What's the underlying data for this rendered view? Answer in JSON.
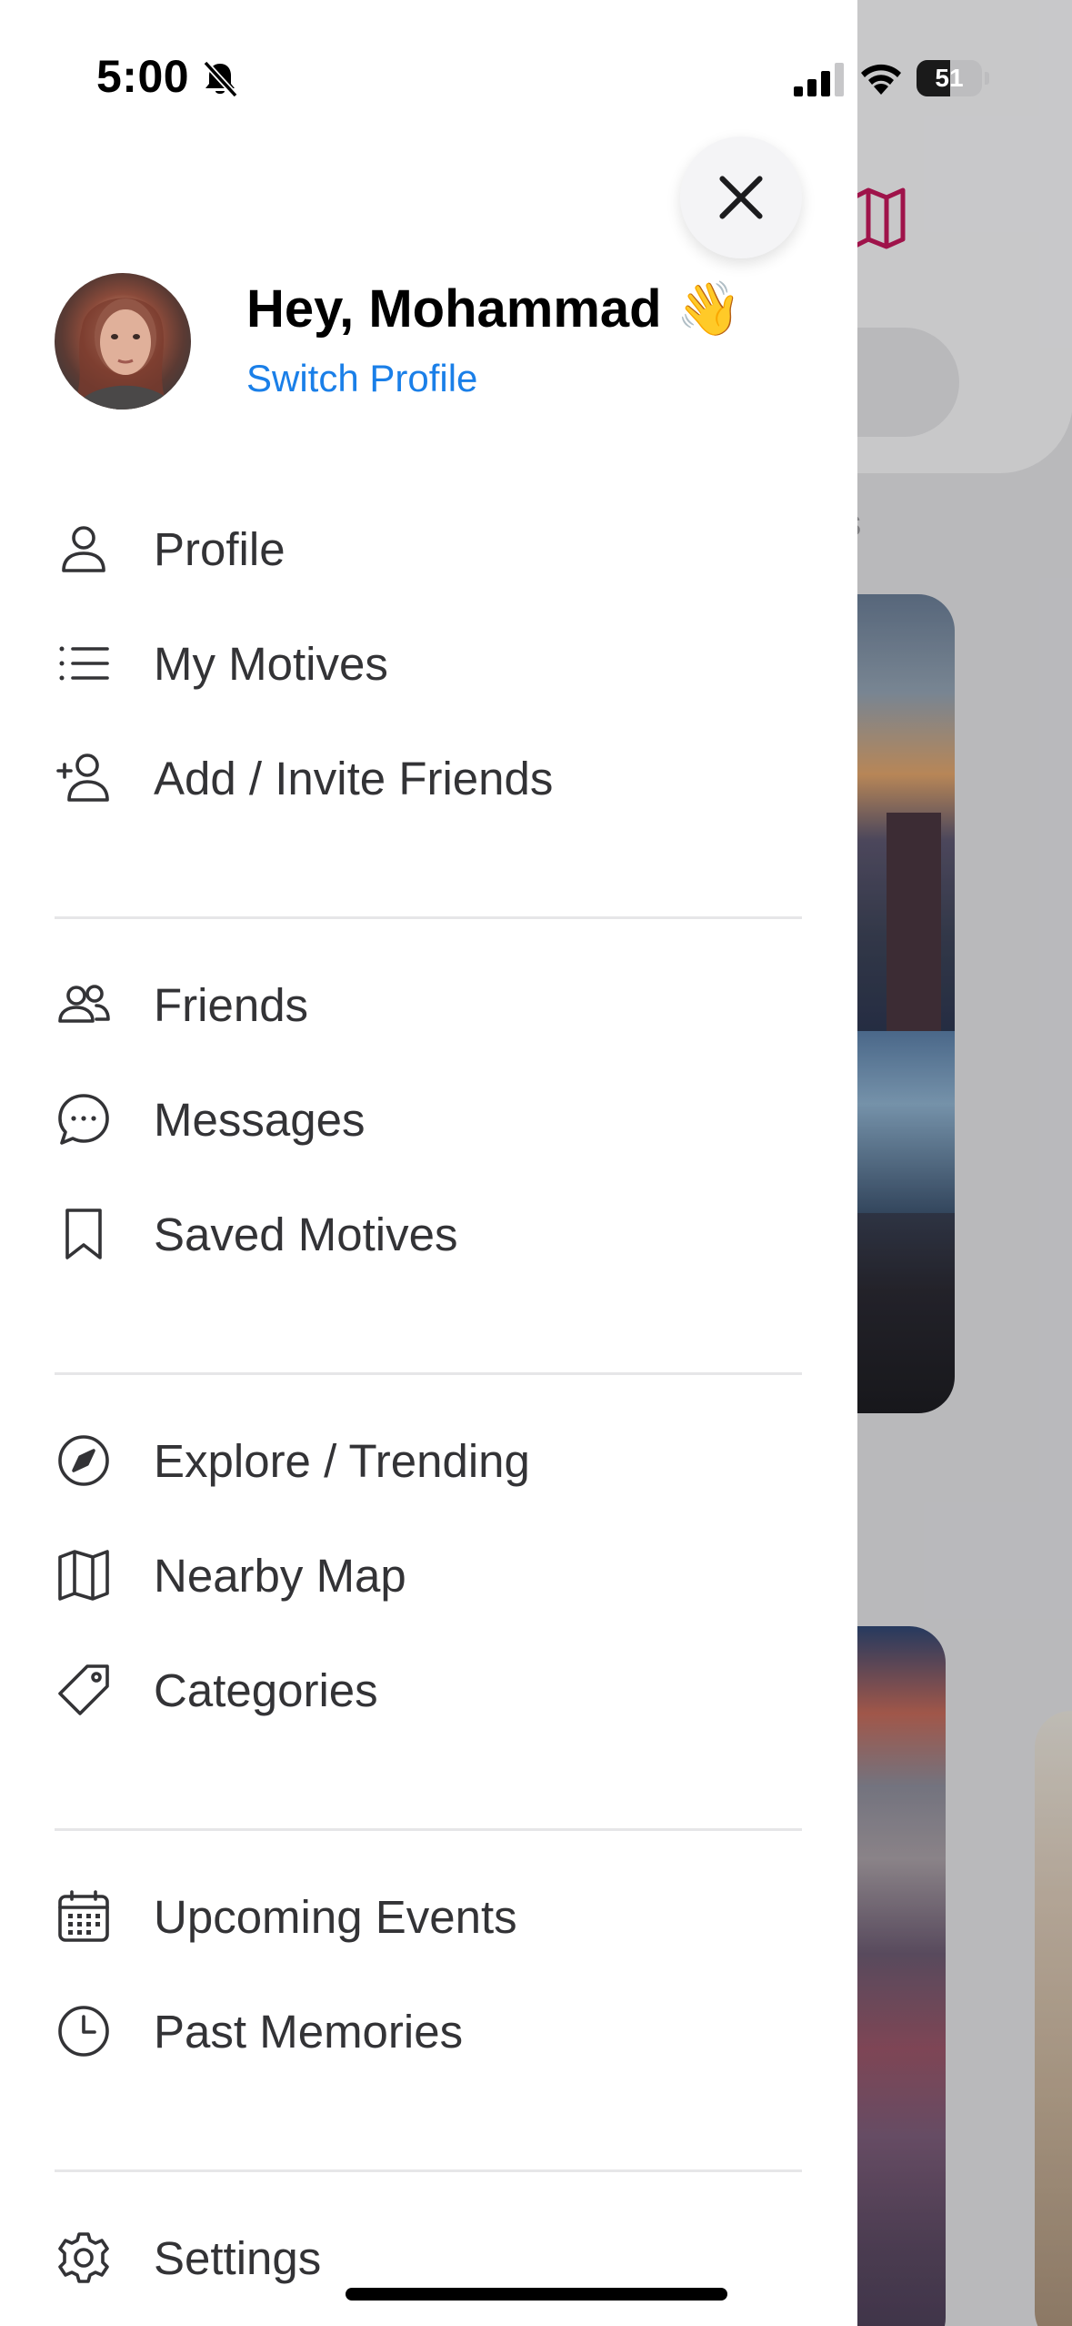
{
  "status_bar": {
    "time": "5:00",
    "battery_level": "51",
    "battery_percent": 51
  },
  "header": {
    "greeting": "Hey, Mohammad 👋",
    "switch_profile_label": "Switch Profile"
  },
  "menu": {
    "group1": [
      {
        "label": "Profile",
        "icon": "person-icon"
      },
      {
        "label": "My Motives",
        "icon": "list-icon"
      },
      {
        "label": "Add / Invite Friends",
        "icon": "add-person-icon"
      }
    ],
    "group2": [
      {
        "label": "Friends",
        "icon": "people-icon"
      },
      {
        "label": "Messages",
        "icon": "chat-bubble-icon"
      },
      {
        "label": "Saved Motives",
        "icon": "bookmark-icon"
      }
    ],
    "group3": [
      {
        "label": "Explore / Trending",
        "icon": "compass-icon"
      },
      {
        "label": "Nearby Map",
        "icon": "map-icon"
      },
      {
        "label": "Categories",
        "icon": "tag-icon"
      }
    ],
    "group4": [
      {
        "label": "Upcoming Events",
        "icon": "calendar-icon"
      },
      {
        "label": "Past Memories",
        "icon": "clock-icon"
      }
    ],
    "group5": [
      {
        "label": "Settings",
        "icon": "gear-icon"
      }
    ]
  },
  "background": {
    "partial_text": "ds"
  },
  "colors": {
    "accent_link": "#1a7fe8",
    "map_icon_bg": "#c2185b",
    "drawer_bg": "#ffffff"
  }
}
